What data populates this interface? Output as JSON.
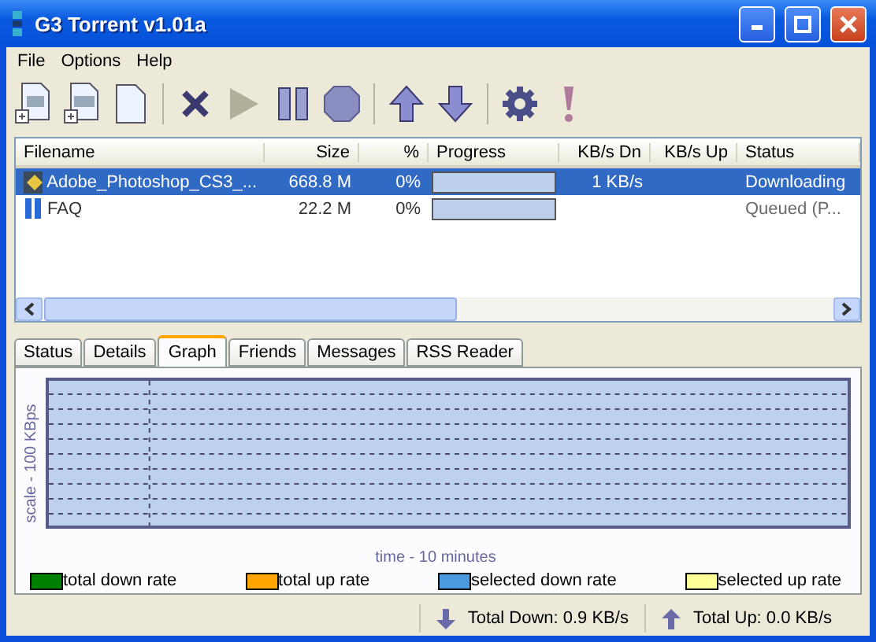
{
  "window": {
    "title": "G3 Torrent v1.01a"
  },
  "menu": [
    "File",
    "Options",
    "Help"
  ],
  "table": {
    "columns": [
      "Filename",
      "Size",
      "%",
      "Progress",
      "KB/s Dn",
      "KB/s Up",
      "Status"
    ],
    "rows": [
      {
        "kind": "downloading",
        "selected": true,
        "filename": "Adobe_Photoshop_CS3_...",
        "size": "668.8 M",
        "percent": "0%",
        "level": 0,
        "down": "1 KB/s",
        "up": "",
        "status": "Downloading"
      },
      {
        "kind": "paused",
        "selected": false,
        "filename": "FAQ",
        "size": "22.2 M",
        "percent": "0%",
        "level": 0,
        "down": "",
        "up": "",
        "status": "Queued (P..."
      }
    ]
  },
  "tabs": [
    {
      "label": "Status",
      "selected": false
    },
    {
      "label": "Details",
      "selected": false
    },
    {
      "label": "Graph",
      "selected": true
    },
    {
      "label": "Friends",
      "selected": false
    },
    {
      "label": "Messages",
      "selected": false
    },
    {
      "label": "RSS Reader",
      "selected": false
    }
  ],
  "graph": {
    "ylabel": "scale - 100 KBps",
    "xlabel": "time - 10 minutes"
  },
  "legend": [
    {
      "label": "total down rate",
      "color": "#008000"
    },
    {
      "label": "total up rate",
      "color": "#ffa500"
    },
    {
      "label": "selected down rate",
      "color": "#4a9ae0"
    },
    {
      "label": "selected up rate",
      "color": "#ffff99"
    }
  ],
  "status_bar": {
    "down": "Total Down: 0.9 KB/s",
    "up": "Total Up: 0.0 KB/s"
  }
}
